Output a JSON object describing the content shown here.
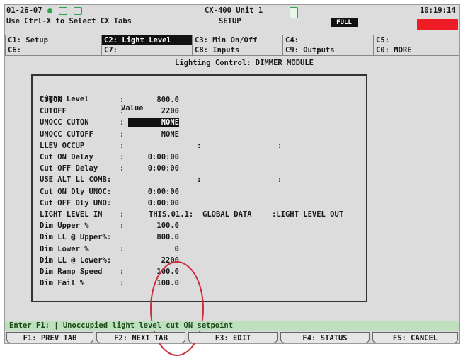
{
  "header": {
    "date": "01-26-07",
    "hint": "Use Ctrl-X to Select CX Tabs",
    "unit": "CX-400 Unit 1",
    "mode": "SETUP",
    "power": "FULL",
    "time": "10:19:14"
  },
  "tabs": [
    {
      "label": "C1: Setup"
    },
    {
      "label": "C2: Light Level"
    },
    {
      "label": "C3: Min On/Off"
    },
    {
      "label": "C4:"
    },
    {
      "label": "C5:"
    },
    {
      "label": "C6:"
    },
    {
      "label": "C7:"
    },
    {
      "label": "C8: Inputs"
    },
    {
      "label": "C9: Outputs"
    },
    {
      "label": "C0: MORE"
    }
  ],
  "page_title": "Lighting Control: DIMMER MODULE",
  "table": {
    "header_label": "Light Level",
    "header_value": "Value",
    "rows": [
      {
        "label": "CUTON",
        "colon": ":",
        "value": "800.0",
        "extra1": "",
        "extra2": "",
        "extra3": ""
      },
      {
        "label": "CUTOFF",
        "colon": ":",
        "value": "2200",
        "extra1": "",
        "extra2": "",
        "extra3": ""
      },
      {
        "label": "UNOCC CUTON",
        "colon": ":",
        "value": "NONE",
        "extra1": "",
        "extra2": "",
        "extra3": ""
      },
      {
        "label": "UNOCC CUTOFF",
        "colon": ":",
        "value": "NONE",
        "extra1": "",
        "extra2": "",
        "extra3": ""
      },
      {
        "label": "LLEV OCCUP",
        "colon": ":",
        "value": "",
        "extra1": ":",
        "extra2": ":",
        "extra3": ""
      },
      {
        "label": "Cut ON Delay",
        "colon": ":",
        "value": "0:00:00",
        "extra1": "",
        "extra2": "",
        "extra3": ""
      },
      {
        "label": "Cut OFF Delay",
        "colon": ":",
        "value": "0:00:00",
        "extra1": "",
        "extra2": "",
        "extra3": ""
      },
      {
        "label": "USE ALT LL COMB:",
        "colon": "",
        "value": "",
        "extra1": ":",
        "extra2": ":",
        "extra3": ""
      },
      {
        "label": "Cut ON Dly UNOC:",
        "colon": "",
        "value": "0:00:00",
        "extra1": "",
        "extra2": "",
        "extra3": ""
      },
      {
        "label": "Cut OFF Dly UNO:",
        "colon": "",
        "value": "0:00:00",
        "extra1": "",
        "extra2": "",
        "extra3": ""
      },
      {
        "label": "LIGHT LEVEL IN",
        "colon": ":",
        "value": "THIS.01.1:",
        "extra1": "GLOBAL DATA",
        "extra2": ":LIGHT LEVEL OUT",
        "extra3": ""
      },
      {
        "label": "Dim Upper %",
        "colon": ":",
        "value": "100.0",
        "extra1": "",
        "extra2": "",
        "extra3": ""
      },
      {
        "label": "Dim LL @ Upper%:",
        "colon": "",
        "value": "800.0",
        "extra1": "",
        "extra2": "",
        "extra3": ""
      },
      {
        "label": "Dim Lower %",
        "colon": ":",
        "value": "0",
        "extra1": "",
        "extra2": "",
        "extra3": ""
      },
      {
        "label": "Dim LL @ Lower%:",
        "colon": "",
        "value": "2200",
        "extra1": "",
        "extra2": "",
        "extra3": ""
      },
      {
        "label": "Dim Ramp Speed",
        "colon": ":",
        "value": "100.0",
        "extra1": "",
        "extra2": "",
        "extra3": ""
      },
      {
        "label": "Dim Fail %",
        "colon": ":",
        "value": "100.0",
        "extra1": "",
        "extra2": "",
        "extra3": ""
      }
    ]
  },
  "status_bar": "Enter  F1: | Unoccupied light level cut ON setpoint",
  "function_keys": [
    {
      "label": "F1: PREV TAB"
    },
    {
      "label": "F2: NEXT TAB"
    },
    {
      "label": "F3: EDIT"
    },
    {
      "label": "F4: STATUS"
    },
    {
      "label": "F5: CANCEL"
    }
  ],
  "colors": {
    "selected_bg": "#111111",
    "alert": "#ee1c25",
    "annotation": "#cc2b3a",
    "status_bg": "#bfe0bf"
  }
}
